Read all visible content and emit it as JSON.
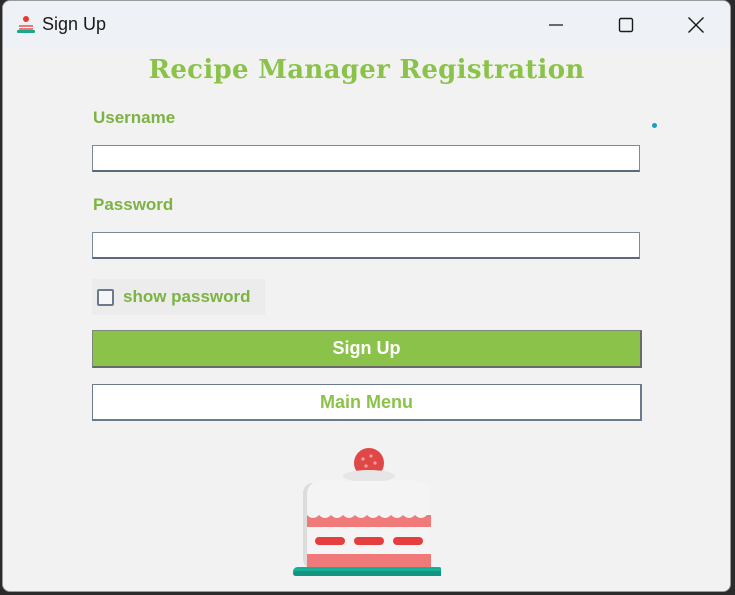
{
  "window": {
    "title": "Sign Up",
    "icon": "cake-icon",
    "controls": [
      "minimize-icon",
      "maximize-icon",
      "close-icon"
    ]
  },
  "form": {
    "heading": "Recipe Manager Registration",
    "username_label": "Username",
    "username_value": "",
    "password_label": "Password",
    "password_value": "",
    "show_password_label": "show password",
    "show_password_checked": false,
    "signup_label": "Sign Up",
    "main_menu_label": "Main Menu"
  },
  "colors": {
    "accent_green": "#8bc34a",
    "label_green": "#7cb342",
    "background": "#f2f2f2"
  },
  "illustration": "strawberry-cake-icon"
}
